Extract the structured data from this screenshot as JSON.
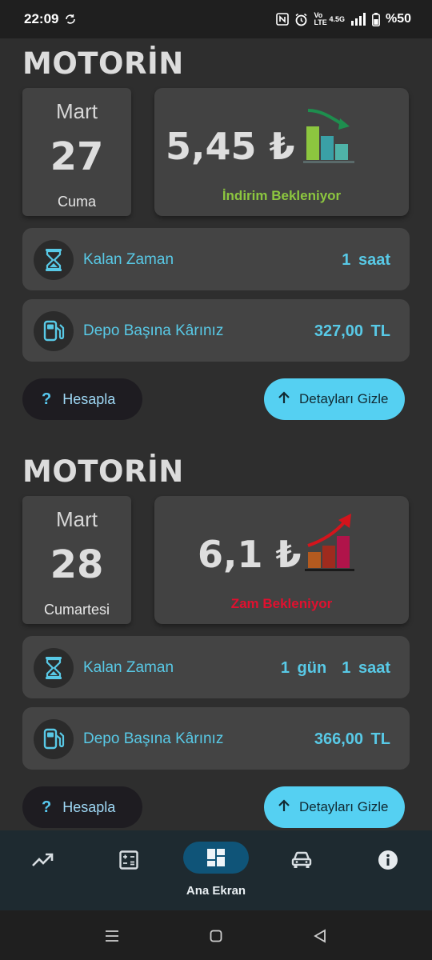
{
  "status_bar": {
    "time": "22:09",
    "network": "4.5G",
    "volte": "Vo LTE",
    "battery": "%50"
  },
  "cards": [
    {
      "fuel": "MOTORİN",
      "month": "Mart",
      "day": "27",
      "weekday": "Cuma",
      "price": "5,45 ₺",
      "status": "İndirim Bekleniyor",
      "status_color": "#8cc63f",
      "trend": "down",
      "remaining_label": "Kalan Zaman",
      "remaining_value": "1 saat",
      "profit_label": "Depo Başına Kârınız",
      "profit_value": "327,00 TL",
      "calc_button": "Hesapla",
      "details_button": "Detayları Gizle"
    },
    {
      "fuel": "MOTORİN",
      "month": "Mart",
      "day": "28",
      "weekday": "Cumartesi",
      "price": "6,1 ₺",
      "status": "Zam Bekleniyor",
      "status_color": "#e0102f",
      "trend": "up",
      "remaining_label": "Kalan Zaman",
      "remaining_value": "1 gün  1 saat",
      "profit_label": "Depo Başına Kârınız",
      "profit_value": "366,00 TL",
      "calc_button": "Hesapla",
      "details_button": "Detayları Gizle"
    }
  ],
  "bottom_nav": {
    "items": [
      {
        "icon": "trending-up-icon"
      },
      {
        "icon": "calculator-icon"
      },
      {
        "icon": "dashboard-icon",
        "label": "Ana Ekran",
        "active": true
      },
      {
        "icon": "car-icon"
      },
      {
        "icon": "info-icon"
      }
    ]
  },
  "colors": {
    "accent": "#55d0f2",
    "text_accent": "#58c9e6",
    "nav_bg": "#1e2a30",
    "nav_active": "#0f5478"
  }
}
